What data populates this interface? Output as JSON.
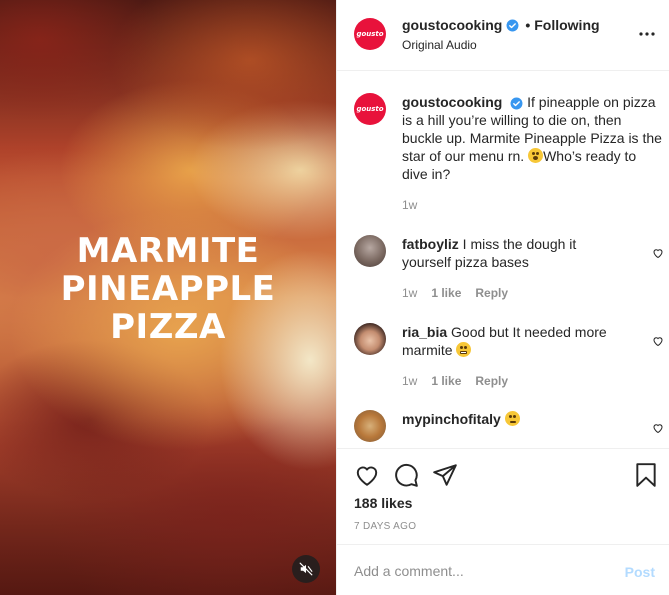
{
  "colors": {
    "brand": "#e8123b",
    "verified": "#3897f0",
    "post_disabled": "#b3dbff",
    "muted": "#8e8e8e"
  },
  "media": {
    "title_lines": [
      "MARMITE",
      "PINEAPPLE",
      "PIZZA"
    ],
    "mute_icon": "speaker-muted-icon"
  },
  "header": {
    "avatar_text": "gousto",
    "username": "goustocooking",
    "separator": "•",
    "follow_label": "Following",
    "audio": "Original Audio",
    "more_icon": "more-options-icon"
  },
  "caption": {
    "avatar_text": "gousto",
    "username": "goustocooking",
    "text_before_emoji": "If pineapple on pizza is a hill you’re willing to die on, then buckle up. Marmite Pineapple Pizza is the star of our menu rn. ",
    "text_after_emoji": "Who’s ready to dive in?",
    "time": "1w"
  },
  "comments": [
    {
      "username": "fatboyliz",
      "text": "I miss the dough it yourself pizza bases",
      "time": "1w",
      "likes": "1 like",
      "reply": "Reply"
    },
    {
      "username": "ria_bia",
      "text": "Good but It needed more marmite",
      "time": "1w",
      "likes": "1 like",
      "reply": "Reply"
    },
    {
      "username": "mypinchofitaly",
      "text": ""
    }
  ],
  "actions": {
    "like_icon": "heart-icon",
    "comment_icon": "comment-icon",
    "share_icon": "send-icon",
    "save_icon": "bookmark-icon",
    "likes": "188 likes",
    "posted": "7 DAYS AGO"
  },
  "add_comment": {
    "placeholder": "Add a comment...",
    "post_label": "Post"
  }
}
